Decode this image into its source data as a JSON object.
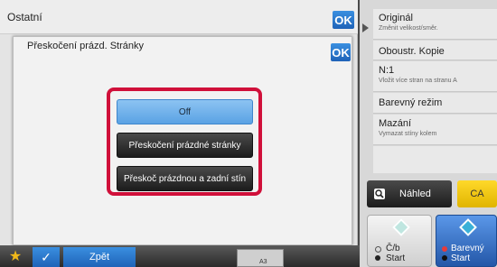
{
  "outer": {
    "title": "Ostatní",
    "ok_label": "OK"
  },
  "dialog": {
    "title": "Přeskočení prázd. Stránky",
    "ok_label": "OK",
    "options": [
      {
        "label": "Off",
        "selected": true
      },
      {
        "label": "Přeskočení prázdné stránky",
        "selected": false
      },
      {
        "label": "Přeskoč prázdnou a zadní stín",
        "selected": false
      }
    ]
  },
  "right_panel": {
    "items": [
      {
        "main": "Originál",
        "sub": "Změnit velikost/směr."
      },
      {
        "main": "Oboustr. Kopie",
        "sub": ""
      },
      {
        "main": "N:1",
        "sub": "Vložit více stran na stranu A"
      },
      {
        "main": "Barevný režim",
        "sub": ""
      },
      {
        "main": "Mazání",
        "sub": "Vymazat stíny kolem"
      }
    ],
    "preview_label": "Náhled",
    "ca_label": "CA",
    "bw_start": {
      "line1": "Č/b",
      "line2": "Start"
    },
    "color_start": {
      "line1": "Barevný",
      "line2": "Start"
    }
  },
  "bottom": {
    "back_label": "Zpět",
    "tray_small": "A3"
  },
  "colors": {
    "highlight": "#d0103a",
    "ok_blue": "#2a78d0",
    "selected_option": "#6fb0ea",
    "ca_yellow": "#f3c800",
    "start_blue": "#2f6cc4"
  }
}
